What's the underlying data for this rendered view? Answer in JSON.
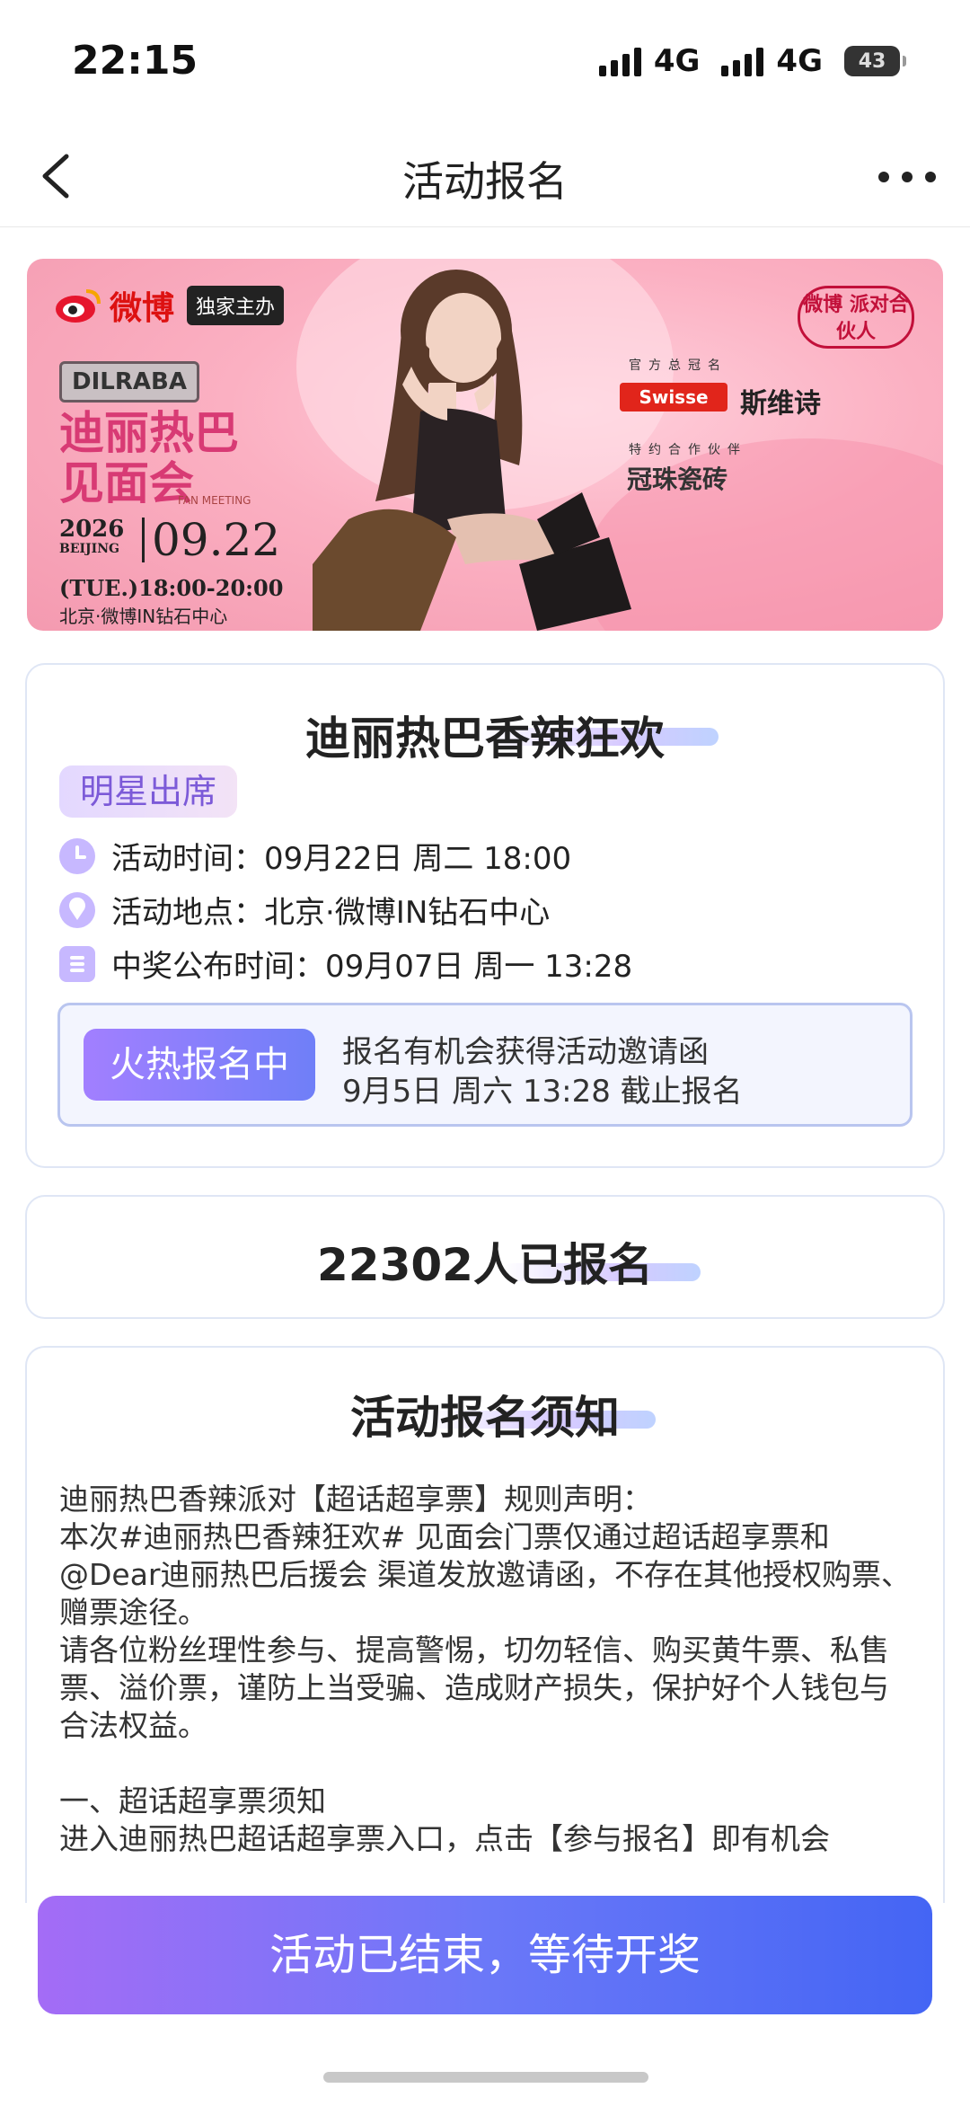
{
  "status_bar": {
    "time": "22:15",
    "net1": "4G",
    "net2": "4G",
    "battery": "43"
  },
  "nav": {
    "title": "活动报名",
    "back_icon": "chevron-left-icon",
    "more_icon": "more-dots-icon"
  },
  "banner": {
    "weibo": "微博",
    "exclusive": "独家主办",
    "dilraba": "DILRABA",
    "event_name_line1": "迪丽热巴",
    "event_name_line2": "见面会",
    "fan_meeting": "FAN MEETING",
    "year": "2026",
    "city_en": "BEIJING",
    "date": "09.22",
    "time": "(TUE.)18:00-20:00",
    "venue": "北京·微博IN钻石中心",
    "party_logo": "微博 派对合伙人",
    "sponsor_title": "官方总冠名",
    "sponsor_brand": "Swisse",
    "sponsor_cn": "斯维诗",
    "partner_title": "特约合作伙伴",
    "partner": "冠珠瓷砖",
    "colors": {
      "pink_bg": "#f7a9be",
      "red": "#d11111"
    }
  },
  "event_card": {
    "title": "迪丽热巴香辣狂欢",
    "tag": "明星出席",
    "time_label": "活动时间：",
    "time_value": "09月22日 周二 18:00",
    "place_label": "活动地点：",
    "place_value": "北京·微博IN钻石中心",
    "result_label": "中奖公布时间：",
    "result_value": "09月07日 周一 13:28",
    "hot_button": "火热报名中",
    "hot_line1": "报名有机会获得活动邀请函",
    "hot_line2": "9月5日 周六 13:28 截止报名"
  },
  "count_card": {
    "text": "22302人已报名"
  },
  "notice_card": {
    "title": "活动报名须知",
    "body": "迪丽热巴香辣派对【超话超享票】规则声明：\n本次#迪丽热巴香辣狂欢# 见面会门票仅通过超话超享票和@Dear迪丽热巴后援会 渠道发放邀请函，不存在其他授权购票、赠票途径。\n请各位粉丝理性参与、提高警惕，切勿轻信、购买黄牛票、私售票、溢价票，谨防上当受骗、造成财产损失，保护好个人钱包与合法权益。\n\n一、超话超享票须知\n进入迪丽热巴超话超享票入口，点击【参与报名】即有机会"
  },
  "cta": {
    "label": "活动已结束，等待开奖"
  },
  "theme": {
    "accent_purple": "#8b6cf6",
    "accent_blue": "#4465f4",
    "card_border": "#dfe6f5"
  }
}
